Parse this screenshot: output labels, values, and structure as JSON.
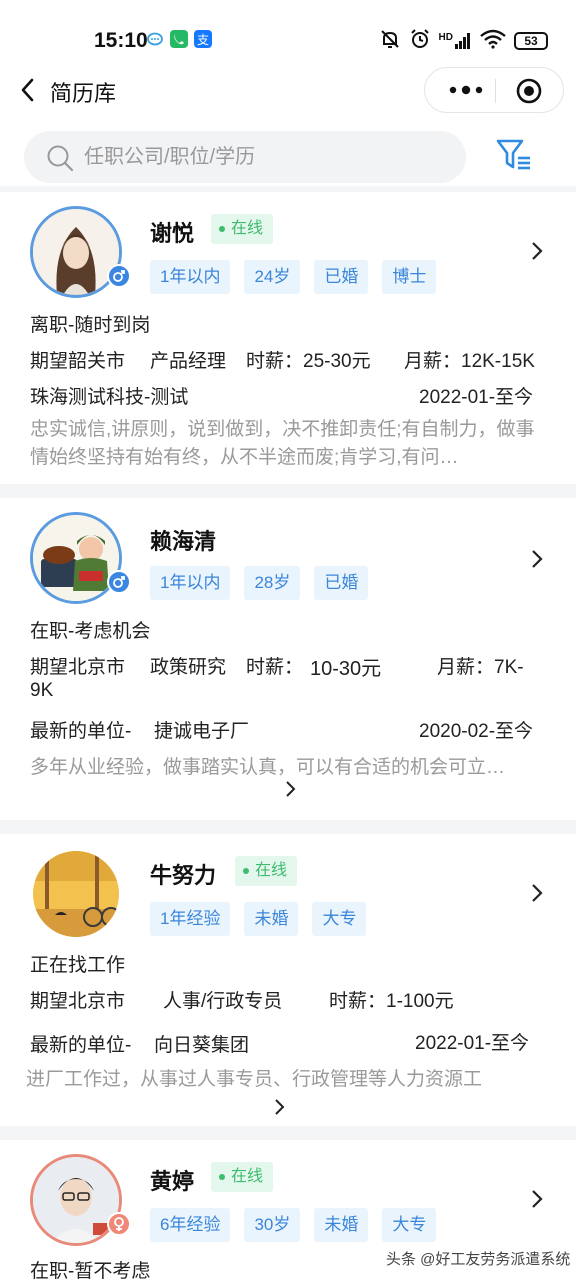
{
  "status_bar": {
    "time": "15:10",
    "battery": "53",
    "network": "HD"
  },
  "nav": {
    "title": "简历库",
    "back_icon": "chevron-left-icon",
    "menu_icon": "more-dots-icon",
    "close_icon": "target-icon"
  },
  "search": {
    "placeholder": "任职公司/职位/学历",
    "value": ""
  },
  "resumes": [
    {
      "name": "谢悦",
      "online": "在线",
      "gender": "male",
      "tags": [
        "1年以内",
        "24岁",
        "已婚",
        "博士"
      ],
      "status": "离职-随时到岗",
      "expect_city": "期望韶关市",
      "expect_job": "产品经理",
      "hourly": "时薪：25-30元",
      "monthly": "月薪：12K-15K",
      "company": "珠海测试科技-测试",
      "period": "2022-01-至今",
      "description": "忠实诚信,讲原则，说到做到，决不推卸责任;有自制力，做事情始终坚持有始有终，从不半途而废;肯学习,有问…"
    },
    {
      "name": "赖海清",
      "gender": "male",
      "tags": [
        "1年以内",
        "28岁",
        "已婚"
      ],
      "status": "在职-考虑机会",
      "expect_city": "期望北京市",
      "expect_job": "政策研究",
      "hourly_label": "时薪：",
      "hourly_value": "10-30元",
      "monthly_a": "月薪：7K-",
      "monthly_b": "9K",
      "company_label": "最新的单位-",
      "company": "捷诚电子厂",
      "period": "2020-02-至今",
      "description": "多年从业经验，做事踏实认真，可以有合适的机会可立…"
    },
    {
      "name": "牛努力",
      "online": "在线",
      "gender": "none",
      "tags": [
        "1年经验",
        "未婚",
        "大专"
      ],
      "status": "正在找工作",
      "expect_city": "期望北京市",
      "expect_job": "人事/行政专员",
      "hourly": "时薪：1-100元",
      "company_label": "最新的单位-",
      "company": "向日葵集团",
      "period": "2022-01-至今",
      "description": "进厂工作过，从事过人事专员、行政管理等人力资源工"
    },
    {
      "name": "黄婷",
      "online": "在线",
      "gender": "female",
      "tags": [
        "6年经验",
        "30岁",
        "未婚",
        "大专"
      ],
      "status": "在职-暂不考虑"
    }
  ],
  "watermark": "头条 @好工友劳务派遣系统",
  "colors": {
    "accent": "#3a86d9",
    "online": "#3dbb6f",
    "tag_bg": "#eaf4fd",
    "separator": "#f4f5f7"
  }
}
